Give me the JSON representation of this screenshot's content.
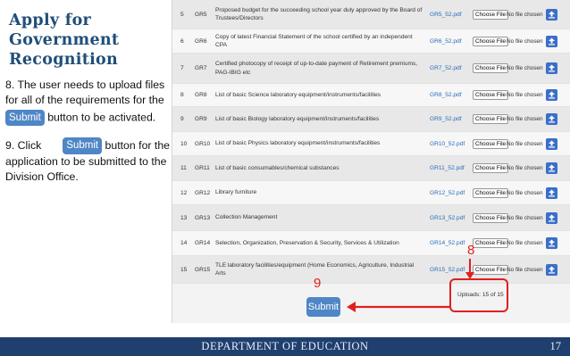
{
  "title_lines": [
    "Apply for",
    "Government",
    "Recognition"
  ],
  "step8": {
    "line1": "8. The user needs to upload files",
    "line2": "for all of the requirements for the",
    "button": "Submit",
    "line3": " button to be activated."
  },
  "step9": {
    "prefix": "9.  Click",
    "button": "Submit",
    "line1_suffix": " button for the",
    "line2": "application to be submitted to the",
    "line3": "Division Office."
  },
  "table": {
    "rows": [
      {
        "num": "5",
        "code": "GR5",
        "desc": "Proposed budget for the succeeding school year duly approved by the Board of Trustees/Directors",
        "file": "GR5_52.pdf",
        "choose": "Choose File",
        "nofile": "No file chosen"
      },
      {
        "num": "6",
        "code": "GR6",
        "desc": "Copy of latest Financial Statement of the school certified by an independent CPA",
        "file": "GR6_52.pdf",
        "choose": "Choose File",
        "nofile": "No file chosen"
      },
      {
        "num": "7",
        "code": "GR7",
        "desc": "Certified photocopy of receipt of up-to-date payment of Retirement premiums, PAG-IBIG etc",
        "file": "GR7_52.pdf",
        "choose": "Choose File",
        "nofile": "No file chosen"
      },
      {
        "num": "8",
        "code": "GR8",
        "desc": "List of basic Science laboratory equipment/instruments/facilities",
        "file": "GR8_52.pdf",
        "choose": "Choose File",
        "nofile": "No file chosen"
      },
      {
        "num": "9",
        "code": "GR9",
        "desc": "List of basic Biology laboratory equipment/instruments/facilities",
        "file": "GR9_52.pdf",
        "choose": "Choose File",
        "nofile": "No file chosen"
      },
      {
        "num": "10",
        "code": "GR10",
        "desc": "List of basic Physics laboratory equipment/instruments/facilities",
        "file": "GR10_52.pdf",
        "choose": "Choose File",
        "nofile": "No file chosen"
      },
      {
        "num": "11",
        "code": "GR11",
        "desc": "List of basic consumables/chemical substances",
        "file": "GR11_52.pdf",
        "choose": "Choose File",
        "nofile": "No file chosen"
      },
      {
        "num": "12",
        "code": "GR12",
        "desc": "Library furniture",
        "file": "GR12_52.pdf",
        "choose": "Choose File",
        "nofile": "No file chosen"
      },
      {
        "num": "13",
        "code": "GR13",
        "desc": "Collection Management",
        "file": "GR13_52.pdf",
        "choose": "Choose File",
        "nofile": "No file chosen"
      },
      {
        "num": "14",
        "code": "GR14",
        "desc": "Selection, Organization, Preservation & Security, Services & Utilization",
        "file": "GR14_52.pdf",
        "choose": "Choose File",
        "nofile": "No file chosen"
      },
      {
        "num": "15",
        "code": "GR15",
        "desc": "TLE laboratory facilities/equipment (Home Economics, Agriculture, Industrial Arts",
        "file": "GR15_52.pdf",
        "choose": "Choose File",
        "nofile": "No file chosen"
      }
    ]
  },
  "uploads_text": "Uploads: 15 of 15",
  "submit_label": "Submit",
  "annotation_8": "8",
  "annotation_9": "9",
  "footer": {
    "text": "DEPARTMENT OF EDUCATION",
    "page": "17"
  },
  "colors": {
    "accent": "#4f86c6",
    "annotation": "#e02020",
    "footer": "#1f3f6e",
    "title": "#1f4e79"
  }
}
